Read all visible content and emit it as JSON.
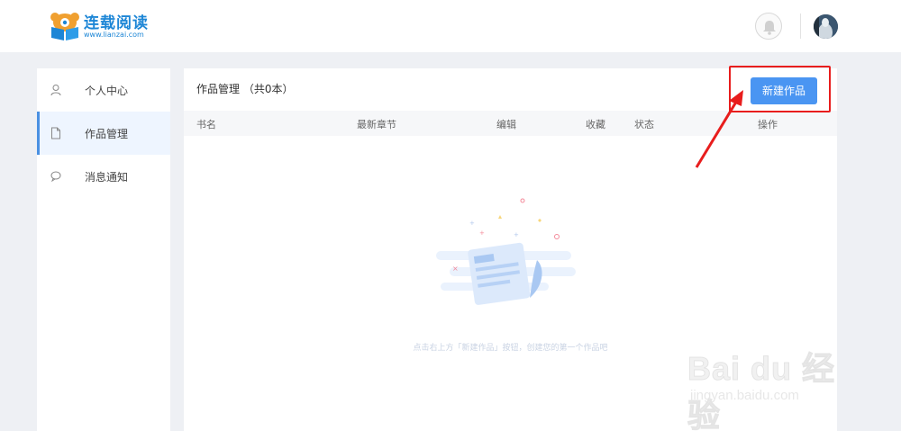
{
  "header": {
    "brand_name": "连载阅读",
    "brand_url": "www.lianzai.com",
    "icons": [
      "logo-icon",
      "bell-icon",
      "avatar"
    ]
  },
  "sidebar": {
    "items": [
      {
        "label": "个人中心",
        "icon": "user-icon",
        "active": false
      },
      {
        "label": "作品管理",
        "icon": "document-icon",
        "active": true
      },
      {
        "label": "消息通知",
        "icon": "chat-bubble-icon",
        "active": false
      }
    ]
  },
  "main": {
    "title": "作品管理 （共0本）",
    "new_button_label": "新建作品",
    "columns": [
      "书名",
      "最新章节",
      "编辑",
      "收藏",
      "状态",
      "操作"
    ],
    "empty_message": "点击右上方「新建作品」按钮，创建您的第一个作品吧"
  },
  "watermark": {
    "main": "Bai du 经验",
    "sub": "jingyan.baidu.com"
  },
  "colors": {
    "accent": "#4a95f2",
    "brand": "#1d86d6",
    "annotation": "#e81d1d",
    "background": "#eef0f4"
  }
}
